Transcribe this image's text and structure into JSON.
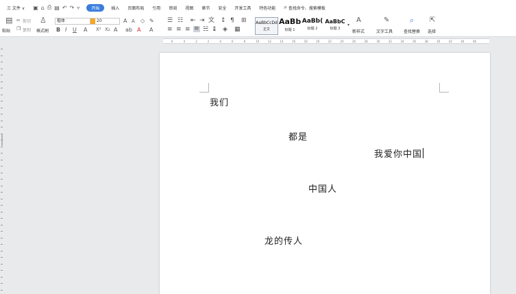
{
  "menubar": {
    "file_label": "三 文件 ∨",
    "tabs": [
      "开始",
      "插入",
      "页面布局",
      "引用",
      "审阅",
      "视图",
      "章节",
      "安全",
      "开发工具",
      "特色功能"
    ],
    "active_tab": "开始",
    "search_label": "查找命令、搜索模板"
  },
  "ribbon": {
    "paste_label": "粘贴",
    "cut_label": "剪切",
    "copy_label": "复制",
    "format_painter_label": "格式刷",
    "font_name": "楷体",
    "font_size": "20",
    "styles": [
      {
        "sample": "AaBbCcDd",
        "label": "正文"
      },
      {
        "sample": "AaBb",
        "label": "标题 1"
      },
      {
        "sample": "AaBb(",
        "label": "标题 2"
      },
      {
        "sample": "AaBbC",
        "label": "标题 3"
      }
    ],
    "new_style_label": "新样式",
    "text_tools_label": "文字工具",
    "find_replace_label": "查找替换",
    "select_label": "选择"
  },
  "ruler": {
    "numbers": [
      "6",
      "4",
      "2",
      "2",
      "4",
      "6",
      "8",
      "10",
      "12",
      "14",
      "16",
      "18",
      "20",
      "22",
      "24",
      "26",
      "28",
      "30",
      "32",
      "34",
      "36",
      "38",
      "40",
      "42",
      "44",
      "46"
    ]
  },
  "document": {
    "lines": [
      "我们",
      "都是",
      "我爱你中国",
      "中国人",
      "龙的传人"
    ]
  }
}
